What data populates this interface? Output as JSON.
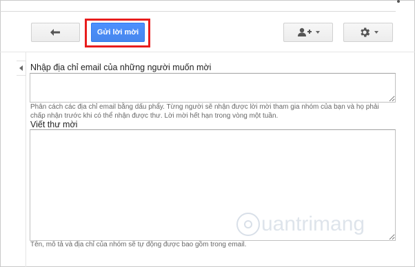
{
  "toolbar": {
    "send_label": "Gửi lời mời",
    "back_icon": "arrow-left-icon",
    "share_icon": "add-person-icon",
    "settings_icon": "gear-icon"
  },
  "form": {
    "email_label": "Nhập địa chỉ email của những người muốn mời",
    "email_value": "",
    "email_hint": "Phân cách các địa chỉ email bằng dấu phẩy. Từng người sẽ nhận được lời mời tham gia nhóm của bạn và họ phải chấp nhận trước khi có thể nhận được thư. Lời mời hết hạn trong vòng một tuần.",
    "message_label": "Viết thư mời",
    "message_value": "",
    "message_hint": "Tên, mô tả và địa chỉ của nhóm sẽ tự động được bao gồm trong email."
  },
  "watermark": {
    "text": "uantrimang"
  },
  "colors": {
    "primary_button": "#4d90fe",
    "highlight_box": "#e81c1c"
  }
}
